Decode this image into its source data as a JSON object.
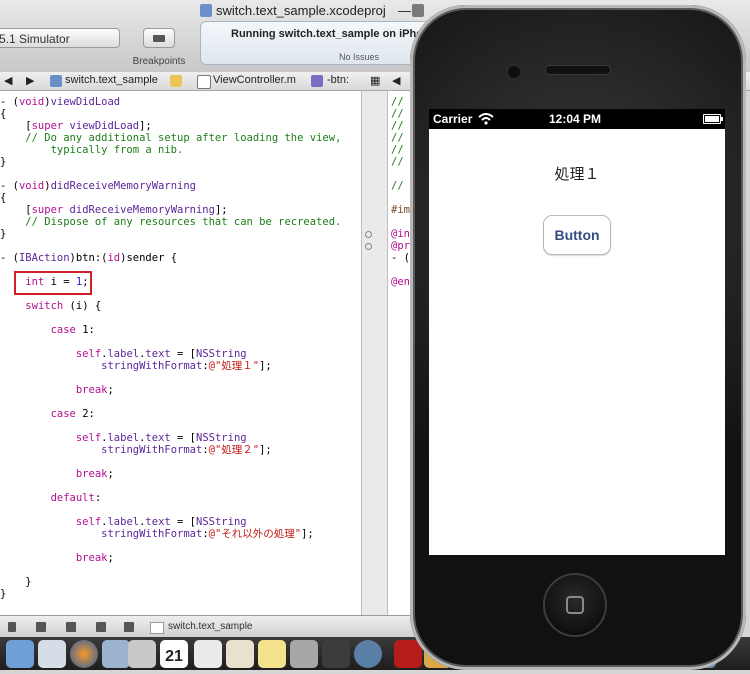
{
  "window": {
    "title": "switch.text_sample.xcodeproj",
    "title_separator": "—"
  },
  "toolbar": {
    "scheme": "5.1 Simulator",
    "breakpoints_label": "Breakpoints"
  },
  "activity": {
    "status": "Running switch.text_sample on iPhone",
    "issues": "No Issues"
  },
  "jump_bar": {
    "project": "switch.text_sample",
    "file": "ViewController.m",
    "method": "-btn:"
  },
  "code": {
    "lines": [
      "- (void)viewDidLoad",
      "{",
      "    [super viewDidLoad];",
      "    // Do any additional setup after loading the view,",
      "        typically from a nib.",
      "}",
      "",
      "- (void)didReceiveMemoryWarning",
      "{",
      "    [super didReceiveMemoryWarning];",
      "    // Dispose of any resources that can be recreated.",
      "}",
      "",
      "- (IBAction)btn:(id)sender {",
      "",
      "    int i = 1;",
      "",
      "    switch (i) {",
      "",
      "        case 1:",
      "",
      "            self.label.text = [NSString",
      "                stringWithFormat:@\"処理１\"];",
      "",
      "            break;",
      "",
      "        case 2:",
      "",
      "            self.label.text = [NSString",
      "                stringWithFormat:@\"処理２\"];",
      "",
      "            break;",
      "",
      "        default:",
      "",
      "            self.label.text = [NSString",
      "                stringWithFormat:@\"それ以外の処理\"];",
      "",
      "            break;",
      "",
      "    }",
      "}"
    ],
    "right_pane_lines": [
      "//",
      "//",
      "//",
      "//",
      "//",
      "//",
      "",
      "//",
      "",
      "#im",
      "",
      "@in",
      "@pr",
      "- (",
      "",
      "@en"
    ]
  },
  "debug_bar": {
    "target": "switch.text_sample"
  },
  "dock": {
    "calendar_day": "21"
  },
  "simulator": {
    "status_bar": {
      "carrier": "Carrier",
      "time": "12:04 PM"
    },
    "label_text": "処理１",
    "button_label": "Button"
  }
}
